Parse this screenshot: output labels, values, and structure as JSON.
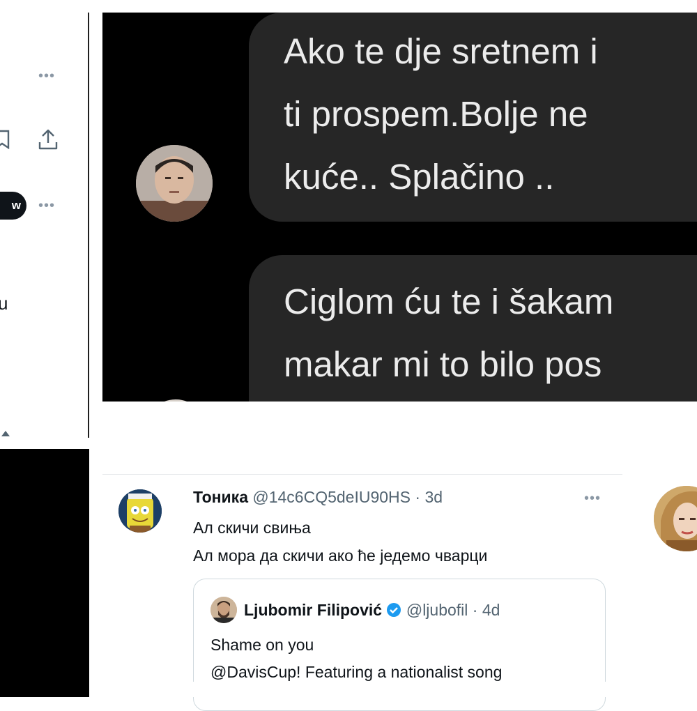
{
  "left_panel": {
    "follow_label": "w",
    "partial_letter": "u"
  },
  "chat": {
    "bubble_1_lines": [
      "Ako te dje sretnem i",
      "ti prospem.Bolje ne",
      "kuće.. Splačino .."
    ],
    "bubble_2_lines": [
      "Ciglom ću te i šakam",
      "makar mi to bilo pos"
    ]
  },
  "tweet": {
    "name": "Тоника",
    "handle": "@14c6CQ5deIU90HS",
    "time": "3d",
    "lines": [
      "Ал скичи свиња",
      "Ал мора да скичи ако ће једемо чварци"
    ]
  },
  "quote": {
    "name": "Ljubomir Filipović",
    "handle": "@ljubofil",
    "time": "4d",
    "lines": [
      "Shame on you",
      "@DavisCup! Featuring a nationalist song"
    ]
  },
  "icons": [
    "more-icon",
    "bookmark-icon",
    "share-icon",
    "verified-badge"
  ],
  "colors": {
    "chat_bg": "#000000",
    "bubble": "#262626",
    "secondary_text": "#536471",
    "border": "#cfd9de"
  }
}
